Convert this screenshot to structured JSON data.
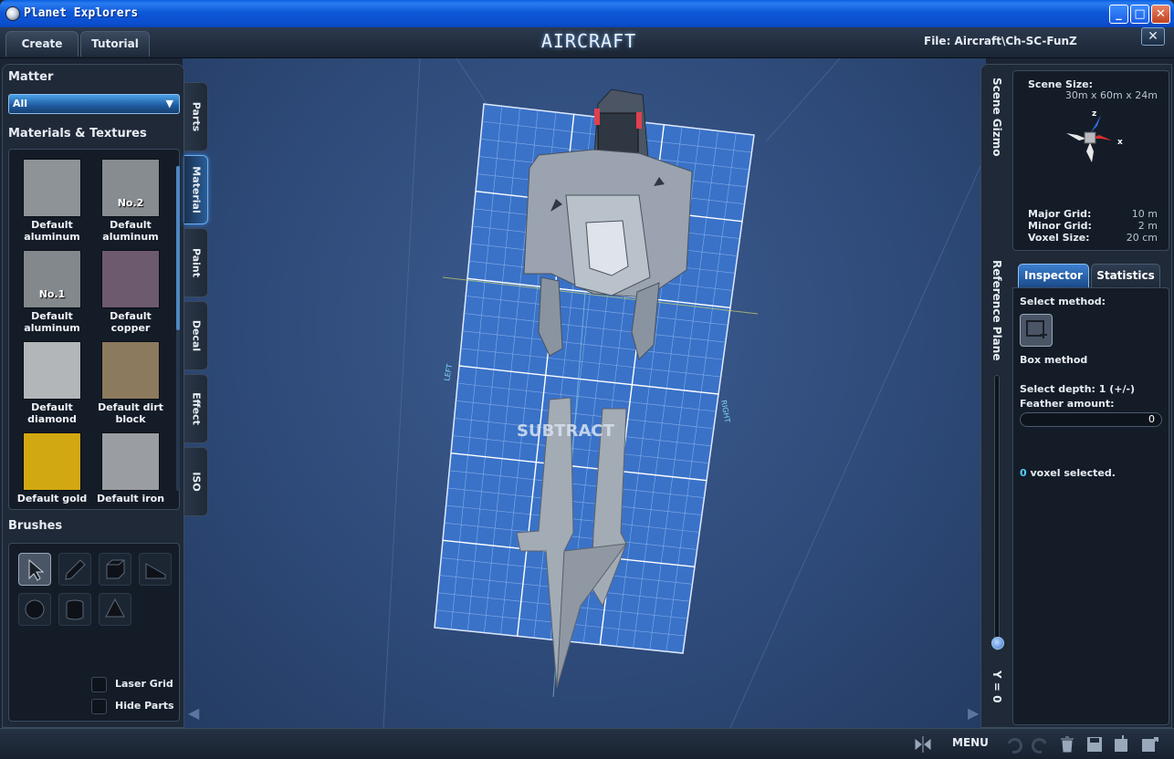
{
  "window": {
    "title": "Planet Explorers"
  },
  "header": {
    "tabs": [
      {
        "label": "Create"
      },
      {
        "label": "Tutorial"
      }
    ],
    "mode_title": "AIRCRAFT",
    "file_label": "File:  Aircraft\\Ch-SC-FunZ"
  },
  "left_panel": {
    "matter_title": "Matter",
    "matter_selected": "All",
    "materials_title": "Materials & Textures",
    "materials": [
      {
        "label": "Default aluminum",
        "tag": "",
        "swatch": "aluminum"
      },
      {
        "label": "Default aluminum",
        "tag": "No.2",
        "swatch": "aluminum"
      },
      {
        "label": "Default aluminum",
        "tag": "No.1",
        "swatch": "aluminum"
      },
      {
        "label": "Default copper",
        "tag": "",
        "swatch": "copper"
      },
      {
        "label": "Default diamond",
        "tag": "",
        "swatch": "diamond"
      },
      {
        "label": "Default dirt block",
        "tag": "",
        "swatch": "dirt"
      },
      {
        "label": "Default gold",
        "tag": "",
        "swatch": "gold"
      },
      {
        "label": "Default iron",
        "tag": "",
        "swatch": "iron"
      }
    ],
    "brushes_title": "Brushes",
    "brushes": [
      {
        "name": "select-arrow-icon",
        "selected": true
      },
      {
        "name": "pencil-icon",
        "selected": false
      },
      {
        "name": "cube-icon",
        "selected": false
      },
      {
        "name": "wedge-icon",
        "selected": false
      },
      {
        "name": "sphere-icon",
        "selected": false
      },
      {
        "name": "cylinder-icon",
        "selected": false
      },
      {
        "name": "cone-icon",
        "selected": false
      }
    ],
    "checkbox_laser": "Laser Grid",
    "checkbox_hide": "Hide Parts"
  },
  "side_tabs": [
    {
      "label": "Parts",
      "active": false
    },
    {
      "label": "Material",
      "active": true
    },
    {
      "label": "Paint",
      "active": false
    },
    {
      "label": "Decal",
      "active": false
    },
    {
      "label": "Effect",
      "active": false
    },
    {
      "label": "ISO",
      "active": false
    }
  ],
  "viewport": {
    "label_left": "LEFT",
    "label_right": "RIGHT",
    "label_subtract": "SUBTRACT"
  },
  "right_panel": {
    "scene_gizmo_label": "Scene Gizmo",
    "scene_size_label": "Scene Size:",
    "scene_size_value": "30m x 60m x 24m",
    "axis_z": "z",
    "axis_x": "x",
    "major_grid_label": "Major Grid:",
    "major_grid_value": "10 m",
    "minor_grid_label": "Minor Grid:",
    "minor_grid_value": "2 m",
    "voxel_size_label": "Voxel Size:",
    "voxel_size_value": "20 cm",
    "reference_plane_label": "Reference Plane",
    "reference_plane_y": "Y = 0",
    "reference_plane_level": 0.0,
    "tabs": {
      "inspector": "Inspector",
      "statistics": "Statistics"
    },
    "select_method_label": "Select method:",
    "box_method_label": "Box method",
    "select_depth_label": "Select depth: 1 (+/-)",
    "feather_label": "Feather amount:",
    "feather_value": "0",
    "voxel_count": "0",
    "voxel_selected_label": " voxel selected."
  },
  "bottom_bar": {
    "menu_label": "MENU"
  },
  "colors": {
    "accent": "#4aa0e8",
    "viewport_bg": "#2f4b7a",
    "grid_fill": "#3a72c8",
    "voxel_count": "#4fd0ff"
  }
}
